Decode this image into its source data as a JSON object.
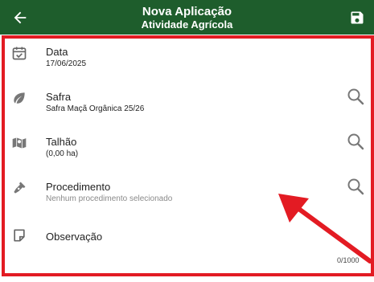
{
  "header": {
    "title": "Nova Aplicação",
    "subtitle": "Atividade Agrícola",
    "back_icon": "arrow-left-icon",
    "save_icon": "floppy-disk-icon",
    "background": "#1e5d2c"
  },
  "fields": {
    "data": {
      "label": "Data",
      "value": "17/06/2025",
      "icon": "calendar-check-icon"
    },
    "safra": {
      "label": "Safra",
      "value": "Safra Maçã Orgânica 25/26",
      "icon": "leaf-icon"
    },
    "talhao": {
      "label": "Talhão",
      "value": "(0,00 ha)",
      "icon": "map-icon"
    },
    "procedimento": {
      "label": "Procedimento",
      "value": "Nenhum procedimento selecionado",
      "icon": "pen-nib-icon"
    },
    "observacao": {
      "label": "Observação",
      "counter": "0/1000",
      "icon": "note-icon"
    }
  },
  "annotation": {
    "color": "#e31b23"
  }
}
